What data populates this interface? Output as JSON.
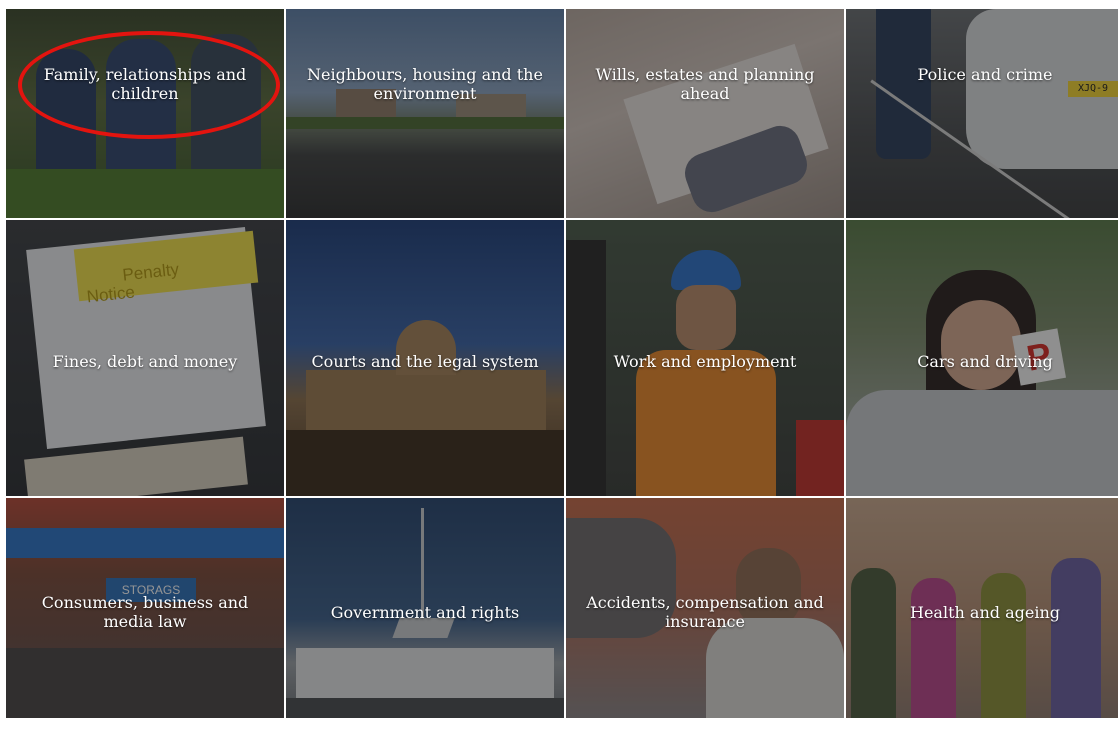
{
  "tiles": [
    {
      "key": "family",
      "label": "Family, relationships and children"
    },
    {
      "key": "neighbours",
      "label": "Neighbours, housing and the environment"
    },
    {
      "key": "wills",
      "label": "Wills, estates and planning ahead"
    },
    {
      "key": "police",
      "label": "Police and crime"
    },
    {
      "key": "fines",
      "label": "Fines, debt and money"
    },
    {
      "key": "courts",
      "label": "Courts and the legal system"
    },
    {
      "key": "work",
      "label": "Work and employment"
    },
    {
      "key": "cars",
      "label": "Cars and driving"
    },
    {
      "key": "consumers",
      "label": "Consumers, business and media law"
    },
    {
      "key": "government",
      "label": "Government and rights"
    },
    {
      "key": "accidents",
      "label": "Accidents, compensation and insurance"
    },
    {
      "key": "health",
      "label": "Health and ageing"
    }
  ],
  "images": {
    "penalty_notice_heading": "Penalty\nNotice",
    "plate_text": "XJQ-9",
    "l_plate_letter": "P",
    "shop_sign": "STORAGS"
  },
  "colors": {
    "overlay": "#141414",
    "highlight_ring": "#e3140f",
    "label_text": "#ffffff"
  }
}
